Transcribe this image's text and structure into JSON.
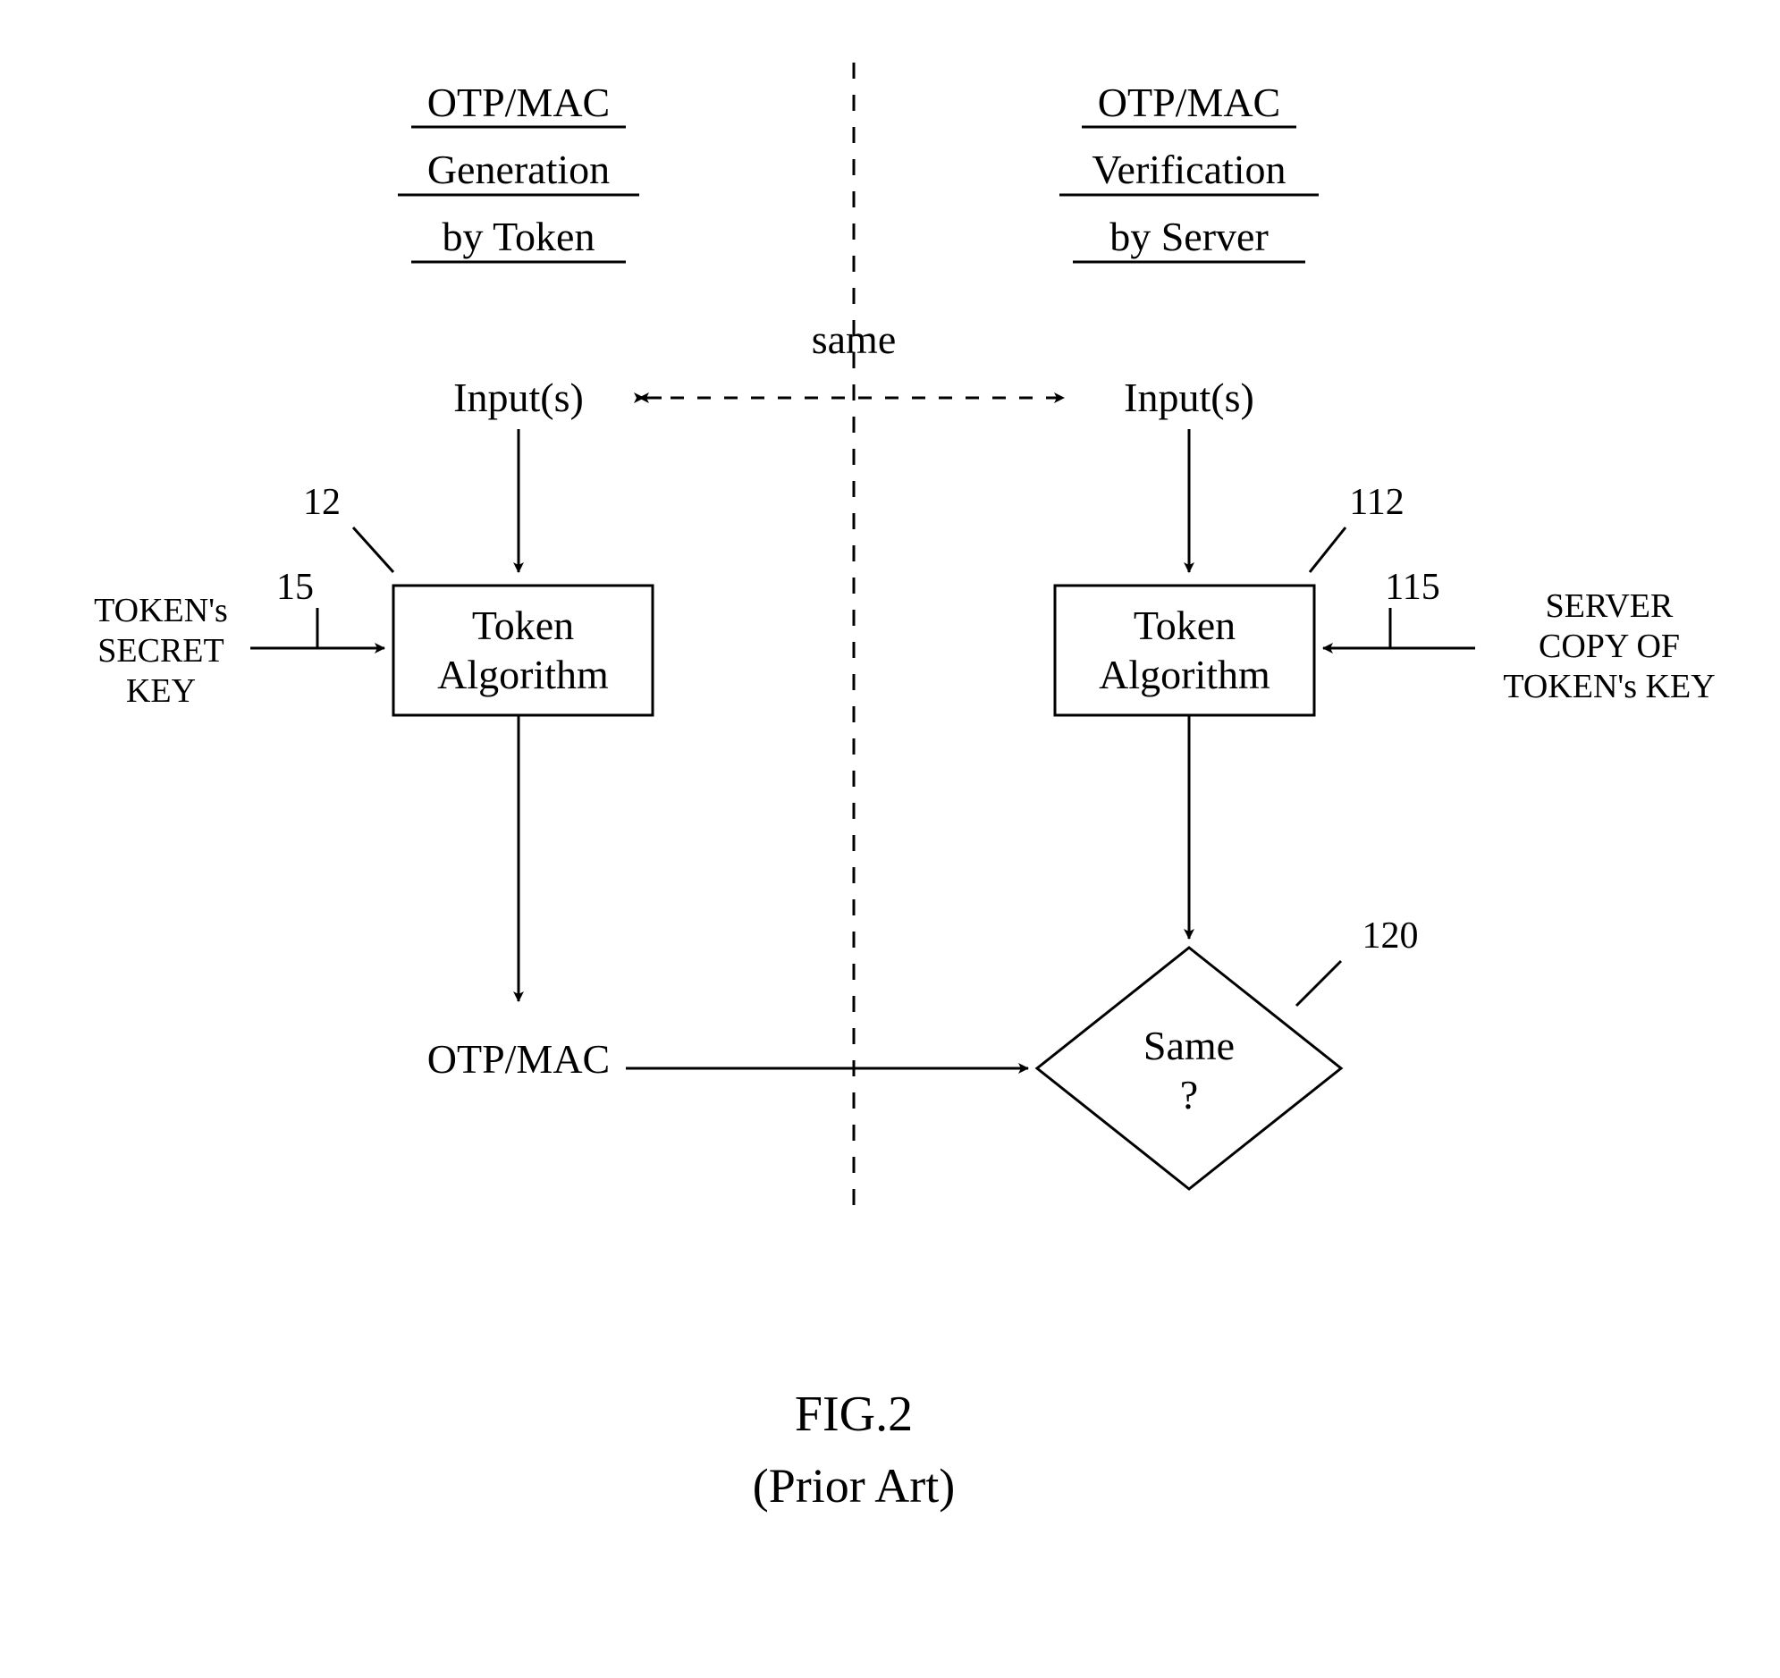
{
  "left": {
    "title_line1": "OTP/MAC",
    "title_line2": "Generation",
    "title_line3": "by Token",
    "inputs": "Input(s)",
    "ref12": "12",
    "ref15": "15",
    "key_line1": "TOKEN's",
    "key_line2": "SECRET",
    "key_line3": "KEY",
    "algo_line1": "Token",
    "algo_line2": "Algorithm",
    "output": "OTP/MAC"
  },
  "right": {
    "title_line1": "OTP/MAC",
    "title_line2": "Verification",
    "title_line3": "by Server",
    "inputs": "Input(s)",
    "ref112": "112",
    "ref115": "115",
    "ref120": "120",
    "key_line1": "SERVER",
    "key_line2": "COPY OF",
    "key_line3": "TOKEN's KEY",
    "algo_line1": "Token",
    "algo_line2": "Algorithm",
    "decision_line1": "Same",
    "decision_line2": "?"
  },
  "center": {
    "same": "same"
  },
  "caption": {
    "fig": "FIG.2",
    "sub": "(Prior Art)"
  }
}
